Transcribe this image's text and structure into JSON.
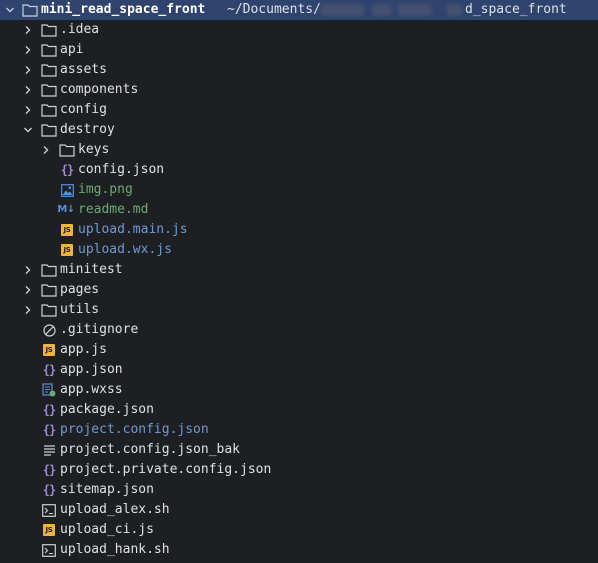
{
  "root": {
    "name": "mini_read_space_front",
    "path_prefix": "~/Documents/",
    "path_suffix": "d_space_front"
  },
  "items": [
    {
      "label": "mini_read_space_front",
      "kind": "root"
    },
    {
      "label": ".idea",
      "kind": "folder",
      "icon": "folder-icon",
      "expanded": false
    },
    {
      "label": "api",
      "kind": "folder",
      "icon": "folder-icon",
      "expanded": false
    },
    {
      "label": "assets",
      "kind": "folder",
      "icon": "folder-icon",
      "expanded": false
    },
    {
      "label": "components",
      "kind": "folder",
      "icon": "folder-icon",
      "expanded": false
    },
    {
      "label": "config",
      "kind": "folder",
      "icon": "folder-icon",
      "expanded": false
    },
    {
      "label": "destroy",
      "kind": "folder",
      "icon": "folder-icon",
      "expanded": true
    },
    {
      "label": "keys",
      "kind": "folder",
      "icon": "folder-icon",
      "expanded": false
    },
    {
      "label": "config.json",
      "kind": "file",
      "icon": "json-icon"
    },
    {
      "label": "img.png",
      "kind": "file",
      "icon": "image-icon"
    },
    {
      "label": "readme.md",
      "kind": "file",
      "icon": "markdown-icon"
    },
    {
      "label": "upload.main.js",
      "kind": "file",
      "icon": "javascript-icon"
    },
    {
      "label": "upload.wx.js",
      "kind": "file",
      "icon": "javascript-icon"
    },
    {
      "label": "minitest",
      "kind": "folder",
      "icon": "folder-icon",
      "expanded": false
    },
    {
      "label": "pages",
      "kind": "folder",
      "icon": "folder-icon",
      "expanded": false
    },
    {
      "label": "utils",
      "kind": "folder",
      "icon": "folder-icon",
      "expanded": false
    },
    {
      "label": ".gitignore",
      "kind": "file",
      "icon": "ignore-icon"
    },
    {
      "label": "app.js",
      "kind": "file",
      "icon": "javascript-icon"
    },
    {
      "label": "app.json",
      "kind": "file",
      "icon": "json-icon"
    },
    {
      "label": "app.wxss",
      "kind": "file",
      "icon": "stylesheet-icon"
    },
    {
      "label": "package.json",
      "kind": "file",
      "icon": "json-icon"
    },
    {
      "label": "project.config.json",
      "kind": "file",
      "icon": "json-icon"
    },
    {
      "label": "project.config.json_bak",
      "kind": "file",
      "icon": "text-file-icon"
    },
    {
      "label": "project.private.config.json",
      "kind": "file",
      "icon": "json-icon"
    },
    {
      "label": "sitemap.json",
      "kind": "file",
      "icon": "json-icon"
    },
    {
      "label": "upload_alex.sh",
      "kind": "file",
      "icon": "shell-script-icon"
    },
    {
      "label": "upload_ci.js",
      "kind": "file",
      "icon": "javascript-icon"
    },
    {
      "label": "upload_hank.sh",
      "kind": "file",
      "icon": "shell-script-icon"
    }
  ],
  "colors": {
    "background": "#1e1f22",
    "selection": "#2e436e",
    "text": "#dfe1e5",
    "folder": "#ced0d6",
    "vcs_added": "#6aab73",
    "vcs_modified": "#6f9bd1",
    "json_icon": "#a18bd8",
    "js_icon": "#f0b43c"
  }
}
